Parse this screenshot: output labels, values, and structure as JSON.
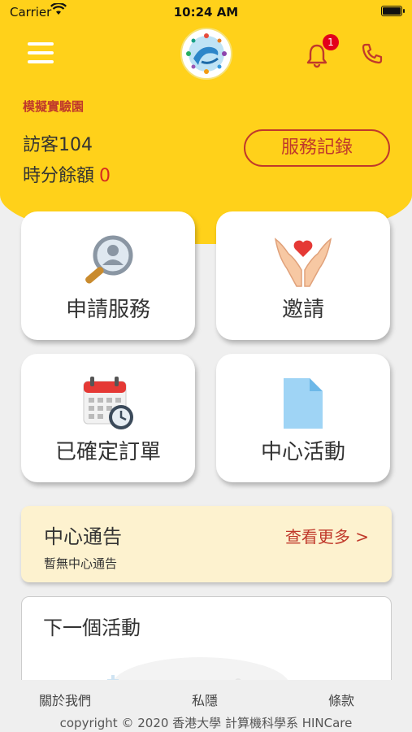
{
  "status_bar": {
    "carrier": "Carrier",
    "time": "10:24 AM"
  },
  "header": {
    "center_name": "模擬實驗園",
    "visitor": "訪客104",
    "balance_label": "時分餘額",
    "balance_value": "0",
    "service_record_label": "服務記錄",
    "notification_count": "1",
    "accent_color": "#ffd11a"
  },
  "tiles": [
    {
      "label": "申請服務",
      "icon": "magnifier-person-icon"
    },
    {
      "label": "邀請",
      "icon": "hands-heart-icon"
    },
    {
      "label": "已確定訂單",
      "icon": "calendar-clock-icon"
    },
    {
      "label": "中心活動",
      "icon": "document-icon"
    }
  ],
  "notice": {
    "title": "中心通告",
    "more_label": "查看更多 >",
    "empty_text": "暫無中心通告"
  },
  "next_activity": {
    "title": "下一個活動"
  },
  "footer": {
    "about": "關於我們",
    "privacy": "私隱",
    "terms": "條款",
    "copyright": "copyright © 2020 香港大學 計算機科學系 HINCare"
  }
}
